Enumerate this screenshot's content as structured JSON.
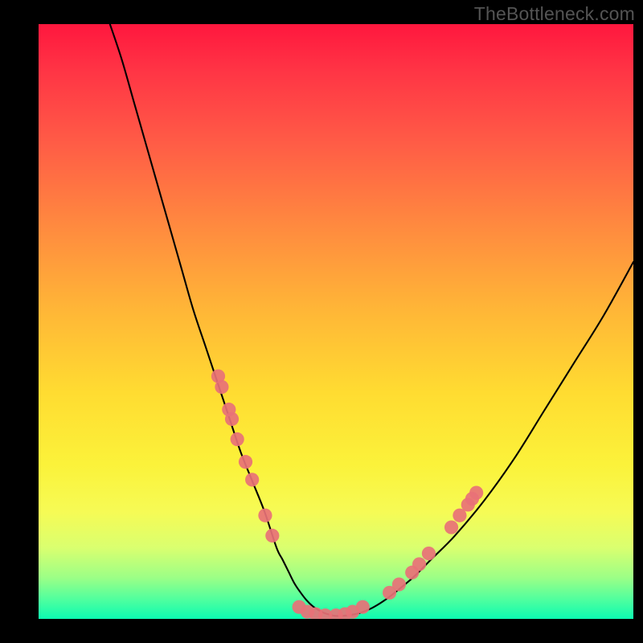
{
  "watermark": "TheBottleneck.com",
  "chart_data": {
    "type": "line",
    "title": "",
    "xlabel": "",
    "ylabel": "",
    "xlim": [
      0,
      100
    ],
    "ylim": [
      0,
      100
    ],
    "curve_x": [
      12,
      14,
      16,
      18,
      20,
      22,
      24,
      26,
      28,
      30,
      32,
      34,
      36,
      38,
      40,
      41,
      42,
      43,
      44,
      45,
      46,
      47,
      48,
      49,
      50,
      52,
      54,
      56,
      58,
      60,
      63,
      66,
      70,
      75,
      80,
      85,
      90,
      95,
      100
    ],
    "curve_y": [
      100,
      94,
      87,
      80,
      73,
      66,
      59,
      52,
      46,
      40,
      34,
      28,
      23,
      18,
      12,
      10,
      8,
      6,
      4.5,
      3.2,
      2.2,
      1.5,
      1.0,
      0.7,
      0.5,
      0.6,
      1.0,
      1.8,
      3.0,
      4.5,
      7,
      10,
      14,
      20,
      27,
      35,
      43,
      51,
      60
    ],
    "markers": [
      {
        "x": 30.2,
        "y": 40.8
      },
      {
        "x": 30.8,
        "y": 39.0
      },
      {
        "x": 32.0,
        "y": 35.2
      },
      {
        "x": 32.5,
        "y": 33.6
      },
      {
        "x": 33.4,
        "y": 30.2
      },
      {
        "x": 34.8,
        "y": 26.4
      },
      {
        "x": 35.9,
        "y": 23.4
      },
      {
        "x": 38.1,
        "y": 17.4
      },
      {
        "x": 39.3,
        "y": 14.0
      },
      {
        "x": 43.8,
        "y": 2.0
      },
      {
        "x": 45.2,
        "y": 1.2
      },
      {
        "x": 46.6,
        "y": 0.8
      },
      {
        "x": 48.2,
        "y": 0.6
      },
      {
        "x": 50.0,
        "y": 0.6
      },
      {
        "x": 51.5,
        "y": 0.8
      },
      {
        "x": 52.8,
        "y": 1.2
      },
      {
        "x": 54.5,
        "y": 2.0
      },
      {
        "x": 59.0,
        "y": 4.4
      },
      {
        "x": 60.6,
        "y": 5.8
      },
      {
        "x": 62.8,
        "y": 7.8
      },
      {
        "x": 64.0,
        "y": 9.2
      },
      {
        "x": 65.6,
        "y": 11.0
      },
      {
        "x": 69.4,
        "y": 15.4
      },
      {
        "x": 70.8,
        "y": 17.4
      },
      {
        "x": 72.2,
        "y": 19.2
      },
      {
        "x": 72.9,
        "y": 20.2
      },
      {
        "x": 73.6,
        "y": 21.2
      }
    ],
    "marker_color": "#e87177",
    "curve_color": "#000000",
    "gradient_stops": [
      {
        "pct": 0,
        "color": "#ff173e"
      },
      {
        "pct": 8,
        "color": "#ff3545"
      },
      {
        "pct": 20,
        "color": "#ff5c46"
      },
      {
        "pct": 34,
        "color": "#ff8a3f"
      },
      {
        "pct": 48,
        "color": "#ffb637"
      },
      {
        "pct": 62,
        "color": "#ffdc31"
      },
      {
        "pct": 74,
        "color": "#fbf23a"
      },
      {
        "pct": 82,
        "color": "#f6fb55"
      },
      {
        "pct": 88,
        "color": "#daff6f"
      },
      {
        "pct": 93,
        "color": "#9dff86"
      },
      {
        "pct": 97,
        "color": "#4affa0"
      },
      {
        "pct": 100,
        "color": "#0cfbb1"
      }
    ]
  }
}
